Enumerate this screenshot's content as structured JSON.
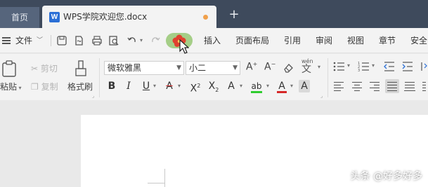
{
  "tabs": {
    "home": "首页",
    "doc_title": "WPS学院欢迎您.docx",
    "doc_icon": "W",
    "new_tab": "+"
  },
  "menu": {
    "file": "文件",
    "items": [
      "插入",
      "页面布局",
      "引用",
      "审阅",
      "视图",
      "章节",
      "安全"
    ]
  },
  "ribbon": {
    "paste": "粘贴",
    "cut": "剪切",
    "copy": "复制",
    "format_painter": "格式刷",
    "font_name": "微软雅黑",
    "font_size": "小二",
    "phonetic": "wén"
  },
  "watermark": "头条 @好多好多",
  "colors": {
    "tabbar": "#3e4a5c",
    "ribbon_bg": "#f3f3f3",
    "accent_highlight": "#a5ce87",
    "flower": "#e0412f",
    "unsaved_dot": "#f0a04b"
  }
}
